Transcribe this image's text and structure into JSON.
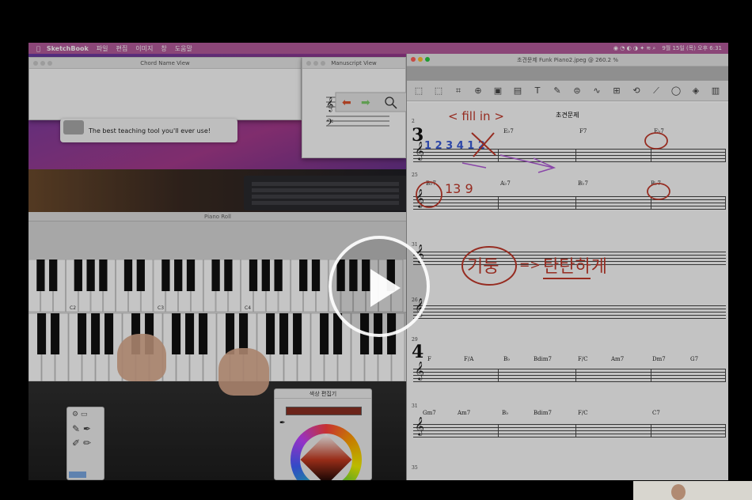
{
  "menubar": {
    "app": "SketchBook",
    "items": [
      "파일",
      "편집",
      "이미지",
      "창",
      "도움말"
    ],
    "clock": "9월 15일 (목) 오후 6:31"
  },
  "chord_name_view": {
    "title": "Chord Name View"
  },
  "manuscript_view": {
    "title": "Manuscript View"
  },
  "toast": {
    "text": "The best teaching tool you'll ever use!"
  },
  "piano_roll": {
    "title": "Piano Roll",
    "octave_labels": [
      "C2",
      "C3",
      "C4"
    ]
  },
  "color_editor": {
    "title": "색상 편집기",
    "current_color": "#8a2f22"
  },
  "preview": {
    "title": "초견문제 Funk Piano2.jpeg @ 260.2 %",
    "score_title": "초견문제",
    "rows": [
      {
        "num": "2",
        "section": "3",
        "chords": [
          "",
          "E♭7",
          "F7",
          "E♭7"
        ]
      },
      {
        "num": "25",
        "section": "",
        "chords": [
          "B♭7",
          "A♭7",
          "B♭7",
          "B♭7"
        ]
      },
      {
        "num": "31",
        "section": "",
        "chords": []
      },
      {
        "num": "26",
        "section": "",
        "chords": []
      },
      {
        "num": "29",
        "section": "4",
        "chords": [
          "F",
          "F/A",
          "B♭",
          "Bdim7",
          "F/C",
          "Am7",
          "Dm7",
          "G7"
        ]
      },
      {
        "num": "31",
        "section": "",
        "chords": [
          "Gm7",
          "Am7",
          "B♭",
          "Bdim7",
          "F/C",
          "",
          "C7",
          ""
        ]
      },
      {
        "num": "35",
        "section": "",
        "chords": []
      }
    ],
    "annotations": {
      "fill_in": "< fill in >",
      "counting": "1 2 3 4 1 2",
      "numbers": "13 9",
      "circled_word": "기둥",
      "arrow": "=>",
      "phrase": "탄탄하게"
    }
  },
  "colors": {
    "ink": "#c0392b",
    "blue_ink": "#3a5bd8",
    "purple_ink": "#b05ad8",
    "menubar": "#b35a9a"
  }
}
